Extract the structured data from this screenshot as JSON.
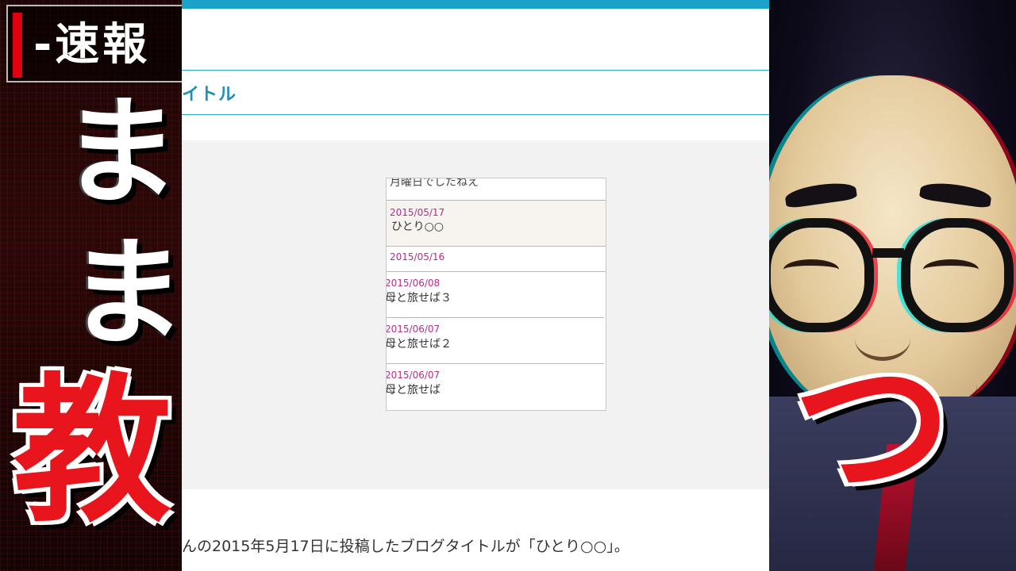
{
  "left_overlay": {
    "banner_text": "-速報",
    "char_top": "ま",
    "char_middle": "ま",
    "char_bottom": "教"
  },
  "right_overlay": {
    "char_bottom": "つ"
  },
  "blog": {
    "title_fragment": "イトル",
    "entries": [
      {
        "date": "",
        "title": "月曜日でしたねえ"
      },
      {
        "date": "2015/05/17",
        "title": "ひとり○○"
      },
      {
        "date": "2015/05/16",
        "title": ""
      },
      {
        "date": "2015/06/08",
        "title": "母と旅せば３"
      },
      {
        "date": "2015/06/07",
        "title": "母と旅せば２"
      },
      {
        "date": "2015/06/07",
        "title": "母と旅せば"
      }
    ],
    "caption": "んの2015年5月17日に投稿したブログタイトルが「ひとり○○」。"
  },
  "colors": {
    "accent": "#1ba2c9",
    "title": "#1f8fb8",
    "date": "#b0308a",
    "overlay_red": "#e8161c"
  }
}
